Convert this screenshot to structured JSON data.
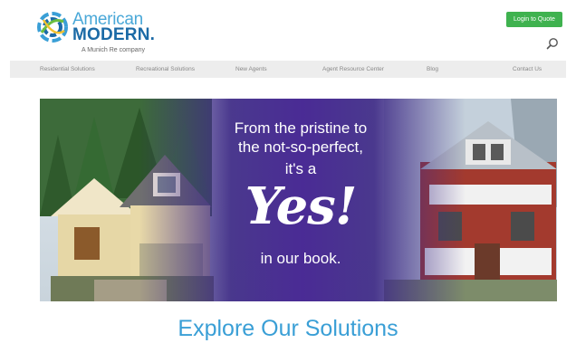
{
  "header": {
    "logo": {
      "line1": "American",
      "line2": "MODERN.",
      "tagline": "A Munich Re company"
    },
    "login_button": "Login to Quote"
  },
  "nav": {
    "items": [
      {
        "label": "Residential Solutions"
      },
      {
        "label": "Recreational Solutions"
      },
      {
        "label": "New Agents"
      },
      {
        "label": "Agent Resource Center"
      },
      {
        "label": "Blog"
      },
      {
        "label": "Contact Us"
      }
    ]
  },
  "hero": {
    "line1": "From the pristine to",
    "line2": "the not-so-perfect,",
    "line3": "it's a",
    "emphasis": "Yes!",
    "line4": "in our book."
  },
  "main": {
    "section_heading": "Explore Our Solutions"
  },
  "colors": {
    "accent": "#3a9fd6",
    "brand_dark": "#1b6aa6",
    "login_green": "#3fb24f",
    "hero_purple": "#4a2a8c"
  },
  "icons": [
    "logo-mark-icon",
    "search-icon"
  ]
}
